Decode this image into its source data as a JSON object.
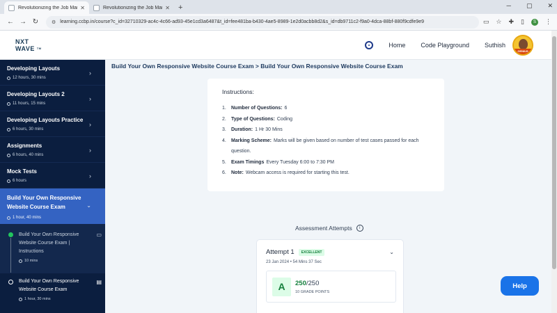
{
  "browser": {
    "tabs": [
      {
        "title": "Revolutionizing the Job Market",
        "active": true
      },
      {
        "title": "Revolutionizing the Job Market",
        "active": false
      }
    ],
    "new_tab": "+",
    "url": "learning.ccbp.in/course?c_id=32710329-ac4c-4c66-ad93-45e1cd3a6487&t_id=fee481ba-b430-4ae5-8989-1e2d0acbb8d2&s_id=db9711c2-f9a0-4dca-88bf-880f9cdfe9e9",
    "profile_initial": "S",
    "window_controls": {
      "min": "─",
      "max": "▢",
      "close": "✕"
    }
  },
  "header": {
    "logo_line1": "NXT",
    "logo_line2": "WAVE",
    "logo_tm": "TM",
    "nav": {
      "home": "Home",
      "playground": "Code Playground"
    },
    "user_name": "Suthish",
    "avatar_badge": "GENIUS"
  },
  "sidebar": {
    "items": [
      {
        "title": "Developing Layouts",
        "duration": "12 hours, 30 mins"
      },
      {
        "title": "Developing Layouts 2",
        "duration": "11 hours, 15 mins"
      },
      {
        "title": "Developing Layouts Practice",
        "duration": "6 hours, 30 mins"
      },
      {
        "title": "Assignments",
        "duration": "6 hours, 40 mins"
      },
      {
        "title": "Mock Tests",
        "duration": "6 hours"
      }
    ],
    "active": {
      "title": "Build Your Own Responsive Website Course Exam",
      "duration": "1 hour, 40 mins"
    },
    "subitems": [
      {
        "title": "Build Your Own Responsive Website Course Exam | Instructions",
        "duration": "10 mins"
      },
      {
        "title": "Build Your Own Responsive Website Course Exam",
        "duration": "1 hour, 30 mins"
      }
    ]
  },
  "content": {
    "breadcrumb": "Build Your Own Responsive Website Course Exam > Build Your Own Responsive Website Course Exam",
    "instructions": {
      "heading": "Instructions:",
      "items": [
        {
          "num": "1.",
          "label": "Number of Questions:",
          "value": "6"
        },
        {
          "num": "2.",
          "label": "Type of Questions:",
          "value": "Coding"
        },
        {
          "num": "3.",
          "label": "Duration:",
          "value": "1 Hr 30 Mins"
        },
        {
          "num": "4.",
          "label": "Marking Scheme:",
          "value": "Marks will be given based on number of test cases passed for each question."
        },
        {
          "num": "5.",
          "label": "Exam Timings",
          "value": "Every Tuesday 6:00 to 7:30 PM"
        },
        {
          "num": "6.",
          "label": "Note:",
          "value": "Webcam access is required for starting this test."
        }
      ]
    },
    "attempts": {
      "title": "Assessment Attempts",
      "attempt_name": "Attempt 1",
      "badge": "EXCELLENT",
      "date": "23 Jan 2024",
      "duration": "54 Mins 37 Sec",
      "grade": "A",
      "score_got": "250",
      "score_total": "/250",
      "grade_points": "10 GRADE POINTS"
    },
    "help": "Help"
  },
  "colors": {
    "sidebar_bg": "#0b1e3f",
    "sidebar_active": "#3463c2",
    "help_button": "#1a73e8",
    "excellent_green": "#15803d"
  }
}
